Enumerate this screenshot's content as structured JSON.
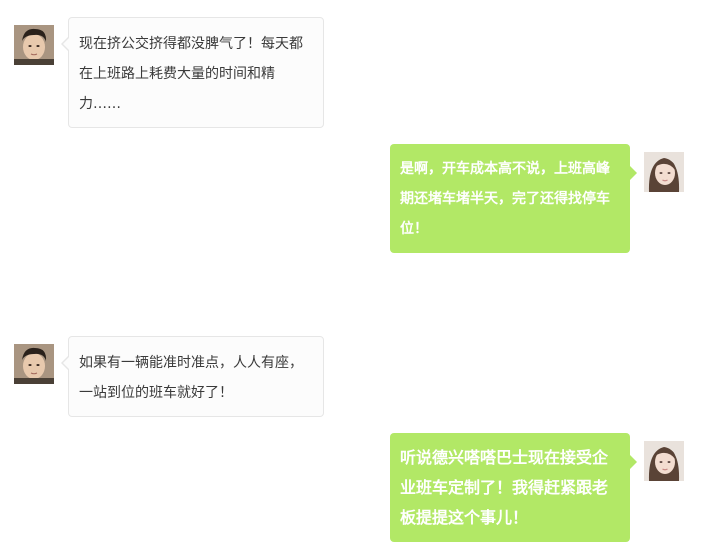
{
  "colors": {
    "incoming_bubble": "#fcfcfc",
    "incoming_border": "#e6e6e6",
    "outgoing_bubble": "#b2e866",
    "outgoing_text": "#ffffff",
    "incoming_text": "#333333"
  },
  "messages": [
    {
      "side": "left",
      "avatar": "male-avatar",
      "text": "现在挤公交挤得都没脾气了！每天都在上班路上耗费大量的时间和精力……"
    },
    {
      "side": "right",
      "avatar": "female-avatar",
      "text": "是啊，开车成本高不说，上班高峰期还堵车堵半天，完了还得找停车位！"
    },
    {
      "side": "left",
      "avatar": "male-avatar",
      "text": "如果有一辆能准时准点，人人有座，一站到位的班车就好了！"
    },
    {
      "side": "right",
      "avatar": "female-avatar",
      "text": "听说德兴嗒嗒巴士现在接受企业班车定制了！我得赶紧跟老板提提这个事儿！"
    }
  ]
}
